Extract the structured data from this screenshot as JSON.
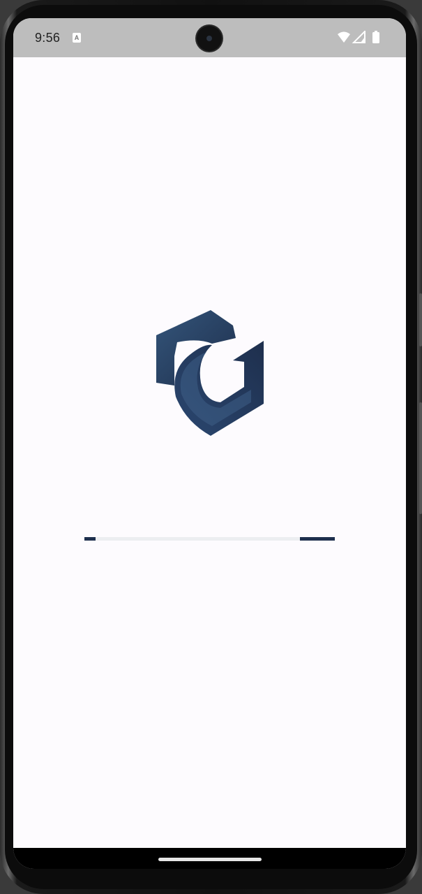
{
  "status_bar": {
    "time": "9:56",
    "notification_icon": "a-letter-icon",
    "notification_letter": "A",
    "icons": [
      "wifi-icon",
      "cellular-signal-icon",
      "battery-icon"
    ]
  },
  "splash": {
    "logo_icon": "brand-b-logo-icon",
    "logo_color": "#1e2f4d",
    "progress_color": "#1e2f4d",
    "progress_track_color": "#eceef1",
    "progress_state": "indeterminate"
  },
  "navigation": {
    "gesture_handle": "gesture-handle"
  }
}
